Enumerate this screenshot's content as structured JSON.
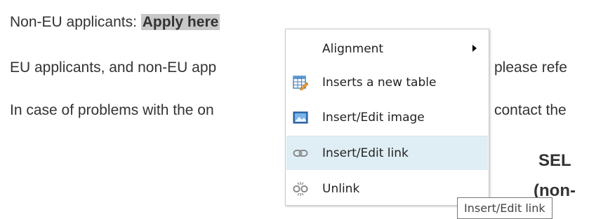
{
  "editor": {
    "line1_prefix": "Non-EU applicants: ",
    "line1_link": "Apply here",
    "line2_left": "EU applicants, and non-EU app",
    "line2_right": "please refe",
    "line3_left": "In case of problems with the on",
    "line3_right": "contact the",
    "heading1_fragment": "SEL",
    "heading2_fragment": "(non-"
  },
  "context_menu": {
    "items": [
      {
        "label": "Alignment",
        "icon": "none",
        "has_submenu": true
      },
      {
        "label": "Inserts a new table",
        "icon": "table-icon",
        "has_submenu": false
      },
      {
        "label": "Insert/Edit image",
        "icon": "image-icon",
        "has_submenu": false
      },
      {
        "label": "Insert/Edit link",
        "icon": "link-icon",
        "has_submenu": false,
        "hovered": true
      },
      {
        "label": "Unlink",
        "icon": "unlink-icon",
        "has_submenu": false
      }
    ]
  },
  "tooltip": {
    "text": "Insert/Edit link"
  },
  "colors": {
    "hover_background": "#dfeef5",
    "selection_background": "#c8c8c8",
    "text": "#333333"
  }
}
